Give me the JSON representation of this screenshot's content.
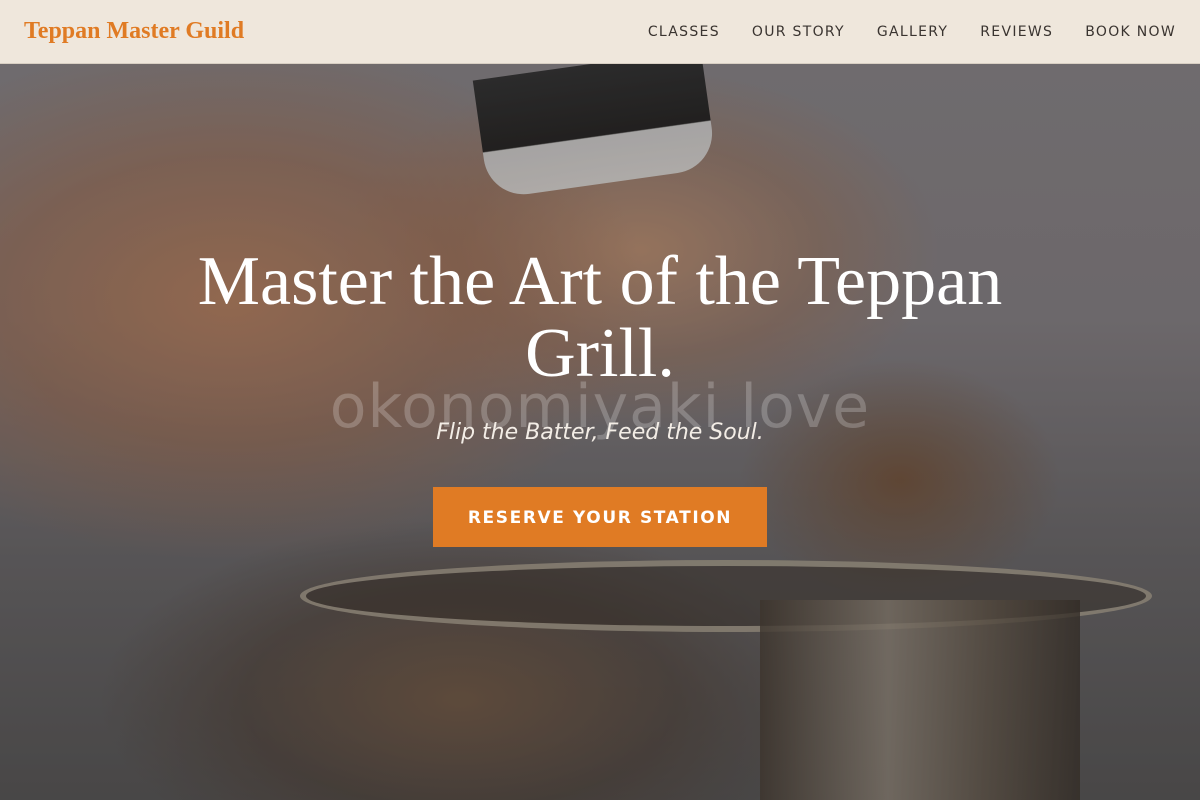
{
  "brand": {
    "name": "Teppan Master Guild",
    "color": "#e07b24"
  },
  "nav": {
    "items": [
      {
        "label": "CLASSES"
      },
      {
        "label": "OUR STORY"
      },
      {
        "label": "GALLERY"
      },
      {
        "label": "REVIEWS"
      },
      {
        "label": "BOOK NOW"
      }
    ]
  },
  "hero": {
    "title": "Master the Art of the Teppan Grill.",
    "watermark": "okonomiyaki love",
    "tagline": "Flip the Batter, Feed the Soul.",
    "cta_label": "RESERVE YOUR STATION",
    "cta_color": "#e07b24"
  }
}
